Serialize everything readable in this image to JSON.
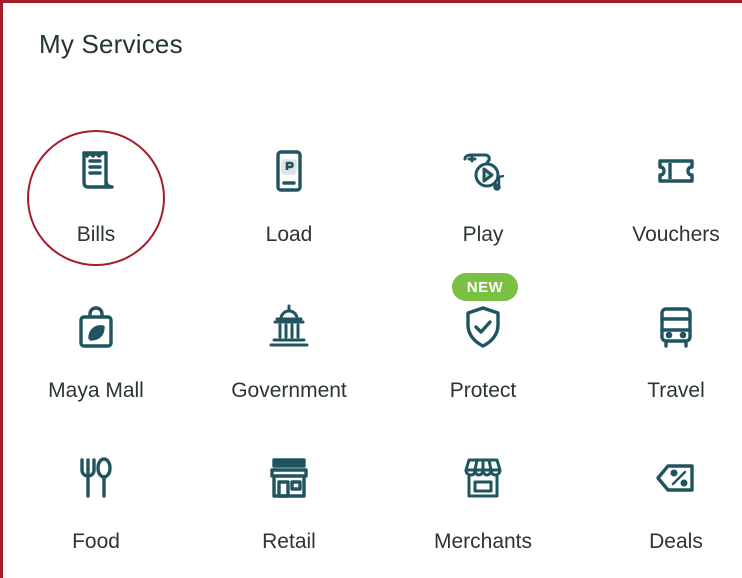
{
  "header": {
    "title": "My Services"
  },
  "colors": {
    "icon": "#20545f",
    "text": "#2c3436",
    "highlight_ring": "#a51d2d",
    "badge_bg": "#79c043",
    "badge_text": "#ffffff"
  },
  "services": [
    {
      "label": "Bills",
      "icon": "receipt-icon"
    },
    {
      "label": "Load",
      "icon": "phone-load-icon"
    },
    {
      "label": "Play",
      "icon": "gamepad-play-icon"
    },
    {
      "label": "Vouchers",
      "icon": "ticket-icon"
    },
    {
      "label": "Maya Mall",
      "icon": "shopping-bag-icon"
    },
    {
      "label": "Government",
      "icon": "government-building-icon"
    },
    {
      "label": "Protect",
      "icon": "shield-check-icon",
      "badge": "NEW"
    },
    {
      "label": "Travel",
      "icon": "bus-icon"
    },
    {
      "label": "Food",
      "icon": "fork-spoon-icon"
    },
    {
      "label": "Retail",
      "icon": "store-icon"
    },
    {
      "label": "Merchants",
      "icon": "storefront-awning-icon"
    },
    {
      "label": "Deals",
      "icon": "discount-tag-icon"
    }
  ]
}
